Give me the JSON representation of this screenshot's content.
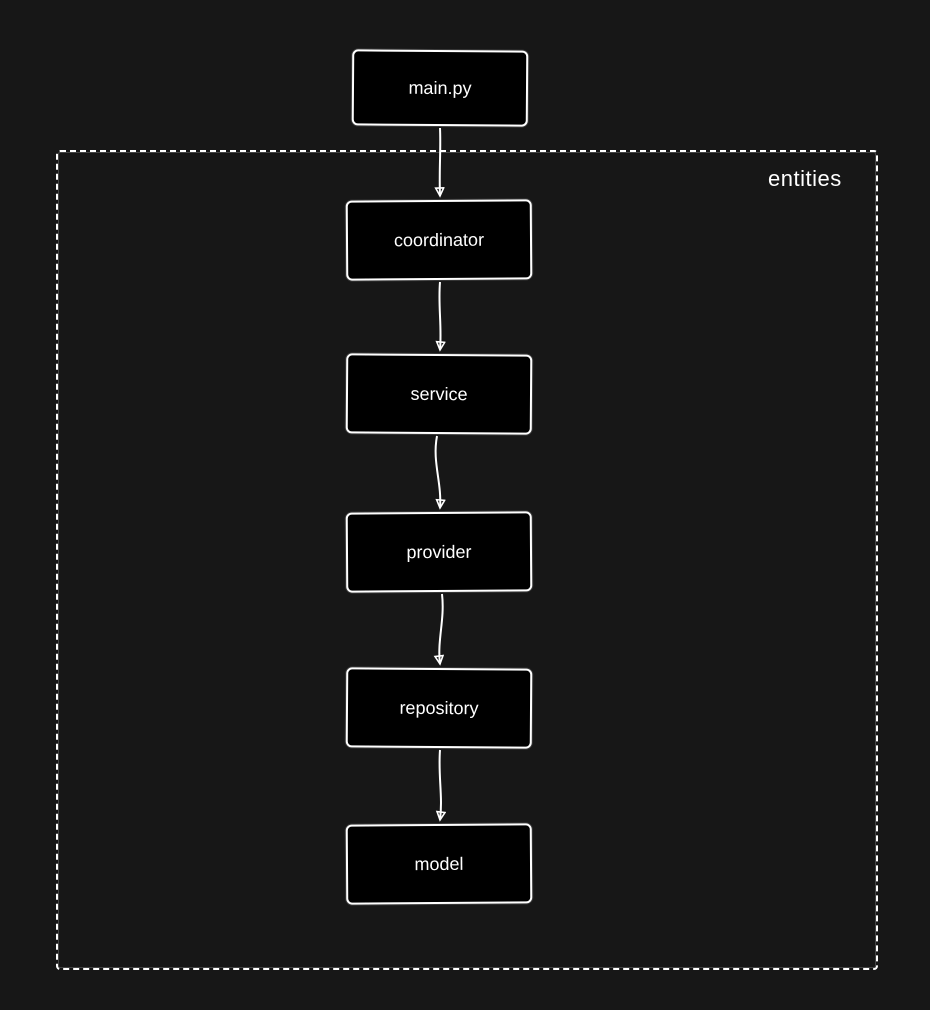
{
  "diagram": {
    "container_label": "entities",
    "nodes": {
      "main": {
        "label": "main.py"
      },
      "coordinator": {
        "label": "coordinator"
      },
      "service": {
        "label": "service"
      },
      "provider": {
        "label": "provider"
      },
      "repository": {
        "label": "repository"
      },
      "model": {
        "label": "model"
      }
    },
    "edges": [
      {
        "from": "main",
        "to": "coordinator"
      },
      {
        "from": "coordinator",
        "to": "service"
      },
      {
        "from": "service",
        "to": "provider"
      },
      {
        "from": "provider",
        "to": "repository"
      },
      {
        "from": "repository",
        "to": "model"
      }
    ],
    "colors": {
      "background": "#171717",
      "node_fill": "#000000",
      "stroke": "#ffffff"
    }
  }
}
